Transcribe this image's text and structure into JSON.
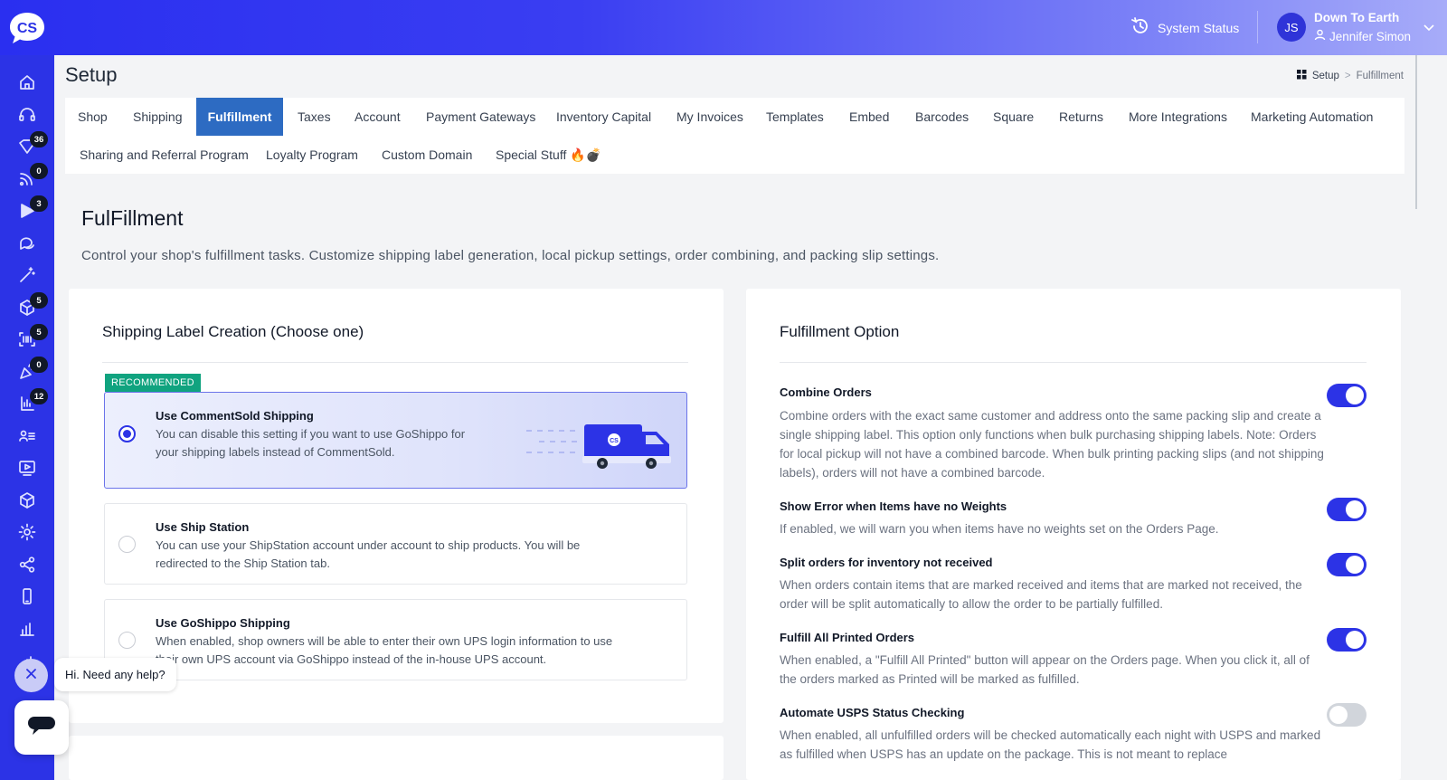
{
  "topbar": {
    "logo_text": "CS",
    "system_status_label": "System Status",
    "user_initials": "JS",
    "shop_name": "Down To Earth",
    "user_name": "Jennifer Simon"
  },
  "sidebar": {
    "badges": {
      "tag": "36",
      "feed": "0",
      "play": "3",
      "box": "5",
      "barcode": "5",
      "party": "0",
      "list": "12"
    }
  },
  "header": {
    "title": "Setup",
    "breadcrumb": {
      "root": "Setup",
      "sep": ">",
      "current": "Fulfillment"
    }
  },
  "tabs": {
    "row1": [
      "Shop",
      "Shipping",
      "Fulfillment",
      "Taxes",
      "Account",
      "Payment Gateways",
      "Inventory Capital",
      "My Invoices",
      "Templates",
      "Embed",
      "Barcodes",
      "Square",
      "Returns",
      "More Integrations",
      "Marketing Automation"
    ],
    "row2": [
      "Sharing and Referral Program",
      "Loyalty Program",
      "Custom Domain",
      "Special Stuff 🔥💣"
    ],
    "active": "Fulfillment"
  },
  "section": {
    "title": "FulFillment",
    "description": "Control your shop's fulfillment tasks. Customize shipping label generation, local pickup settings, order combining, and packing slip settings."
  },
  "shipping_label": {
    "title": "Shipping Label Creation (Choose one)",
    "recommended_badge": "RECOMMENDED",
    "truck_logo": "CS",
    "options": [
      {
        "title": "Use CommentSold Shipping",
        "desc_line1": "You can disable this setting if you want to use GoShippo for",
        "desc_line2": "your shipping labels instead of CommentSold.",
        "selected": true
      },
      {
        "title": "Use Ship Station",
        "desc_line1": "You can use your ShipStation account under account to ship products. You will be",
        "desc_line2": "redirected to the Ship Station tab.",
        "selected": false
      },
      {
        "title": "Use GoShippo Shipping",
        "desc_line1": "When enabled, shop owners will be able to enter their own UPS login information to use",
        "desc_line2": "their own UPS account via GoShippo instead of the in-house UPS account.",
        "selected": false
      }
    ]
  },
  "fulfillment_option": {
    "title": "Fulfillment Option",
    "items": [
      {
        "title": "Combine Orders",
        "desc": "Combine orders with the exact same customer and address onto the same packing slip and create a single shipping label. This option only functions when bulk purchasing shipping labels. Note: Orders for local pickup will not have a combined barcode. When bulk printing packing slips (and not shipping labels), orders will not have a combined barcode.",
        "enabled": true
      },
      {
        "title": "Show Error when Items have no Weights",
        "desc": "If enabled, we will warn you when items have no weights set on the Orders Page.",
        "enabled": true
      },
      {
        "title": "Split orders for inventory not received",
        "desc": "When orders contain items that are marked received and items that are marked not received, the order will be split automatically to allow the order to be partially fulfilled.",
        "enabled": true
      },
      {
        "title": "Fulfill All Printed Orders",
        "desc": "When enabled, a \"Fulfill All Printed\" button will appear on the Orders page. When you click it, all of the orders marked as Printed will be marked as fulfilled.",
        "enabled": true
      },
      {
        "title": "Automate USPS Status Checking",
        "desc": "When enabled, all unfulfilled orders will be checked automatically each night with USPS and marked as fulfilled when USPS has an update on the package. This is not meant to replace",
        "enabled": false
      }
    ]
  },
  "chat": {
    "greeting": "Hi. Need any help?"
  },
  "colors": {
    "primary": "#2c33e6",
    "tab_active": "#2d6bc2",
    "recommended": "#10a37f"
  }
}
